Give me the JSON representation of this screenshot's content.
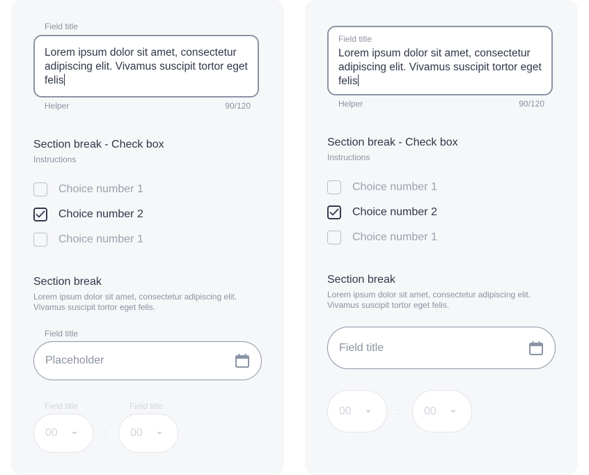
{
  "left": {
    "textarea": {
      "title": "Field title",
      "value": "Lorem ipsum dolor sit amet, consectetur adipiscing elit. Vivamus suscipit tortor eget felis",
      "helper": "Helper",
      "counter": "90/120"
    },
    "checkbox_section": {
      "title": "Section break - Check box",
      "instructions": "Instructions",
      "choices": [
        {
          "label": "Choice number 1",
          "checked": false
        },
        {
          "label": "Choice number 2",
          "checked": true
        },
        {
          "label": "Choice number 1",
          "checked": false
        }
      ]
    },
    "section": {
      "title": "Section break",
      "description": "Lorem ipsum dolor sit amet, consectetur adipiscing elit. Vivamus suscipit tortor eget felis."
    },
    "date_field": {
      "title": "Field title",
      "placeholder": "Placeholder",
      "icon": "calendar-icon"
    },
    "time": {
      "hour": {
        "title": "Field title",
        "value": "00"
      },
      "separator": ":",
      "minute": {
        "title": "Field title",
        "value": "00"
      }
    }
  },
  "right": {
    "textarea": {
      "title": "Field title",
      "value": "Lorem ipsum dolor sit amet, consectetur adipiscing elit. Vivamus suscipit tortor eget felis",
      "helper": "Helper",
      "counter": "90/120"
    },
    "checkbox_section": {
      "title": "Section break - Check box",
      "instructions": "Instructions",
      "choices": [
        {
          "label": "Choice number 1",
          "checked": false
        },
        {
          "label": "Choice number 2",
          "checked": true
        },
        {
          "label": "Choice number 1",
          "checked": false
        }
      ]
    },
    "section": {
      "title": "Section break",
      "description": "Lorem ipsum dolor sit amet, consectetur adipiscing elit. Vivamus suscipit tortor eget felis."
    },
    "date_field": {
      "placeholder": "Field title",
      "icon": "calendar-icon"
    },
    "time": {
      "hour": {
        "value": "00"
      },
      "separator": ":",
      "minute": {
        "value": "00"
      }
    }
  }
}
